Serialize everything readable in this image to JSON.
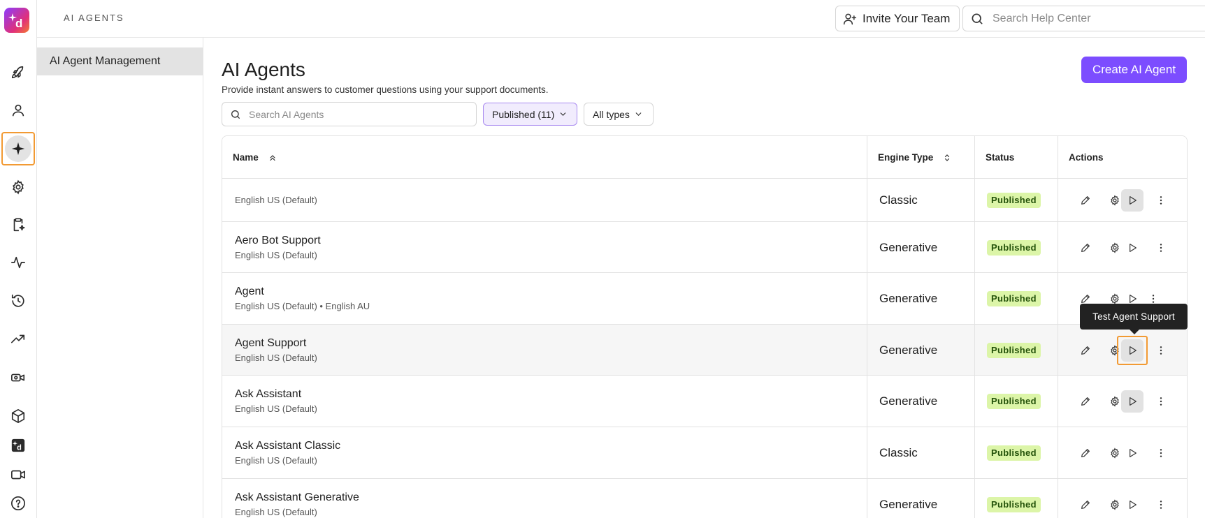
{
  "topbar": {
    "breadcrumb": "AI AGENTS",
    "invite_label": "Invite Your Team",
    "help_search_placeholder": "Search Help Center"
  },
  "sidebar": {
    "items": [
      {
        "icon": "rocket-icon"
      },
      {
        "icon": "user-icon"
      },
      {
        "icon": "sparkle-icon",
        "active": true
      },
      {
        "icon": "gear-icon"
      },
      {
        "icon": "clipboard-sparkle-icon"
      },
      {
        "icon": "activity-icon"
      },
      {
        "icon": "history-icon"
      },
      {
        "icon": "trending-up-icon"
      },
      {
        "icon": "camera-settings-icon"
      },
      {
        "icon": "cube-icon"
      },
      {
        "icon": "brand-d-icon"
      },
      {
        "icon": "video-icon"
      },
      {
        "icon": "help-icon"
      }
    ]
  },
  "subnav": {
    "active_label": "AI Agent Management"
  },
  "main": {
    "title": "AI Agents",
    "subtitle": "Provide instant answers to customer questions using your support documents.",
    "create_label": "Create AI Agent",
    "search_placeholder": "Search AI Agents",
    "filter_status": "Published (11)",
    "filter_type": "All types"
  },
  "table": {
    "headers": {
      "name": "Name",
      "engine": "Engine Type",
      "status": "Status",
      "actions": "Actions"
    },
    "rows": [
      {
        "name": "",
        "langs": "English US (Default)",
        "engine": "Classic",
        "status": "Published"
      },
      {
        "name": "Aero Bot Support",
        "langs": "English US (Default)",
        "engine": "Generative",
        "status": "Published"
      },
      {
        "name": "Agent",
        "langs": "English US (Default) • English AU",
        "engine": "Generative",
        "status": "Published"
      },
      {
        "name": "Agent Support",
        "langs": "English US (Default)",
        "engine": "Generative",
        "status": "Published"
      },
      {
        "name": "Ask Assistant",
        "langs": "English US (Default)",
        "engine": "Generative",
        "status": "Published"
      },
      {
        "name": "Ask Assistant Classic",
        "langs": "English US (Default)",
        "engine": "Classic",
        "status": "Published"
      },
      {
        "name": "Ask Assistant Generative",
        "langs": "English US (Default)",
        "engine": "Generative",
        "status": "Published"
      }
    ]
  },
  "tooltip": "Test Agent Support",
  "colors": {
    "accent": "#7c4dff",
    "badge_bg": "#dcf5a8",
    "focus": "#f29a33"
  }
}
